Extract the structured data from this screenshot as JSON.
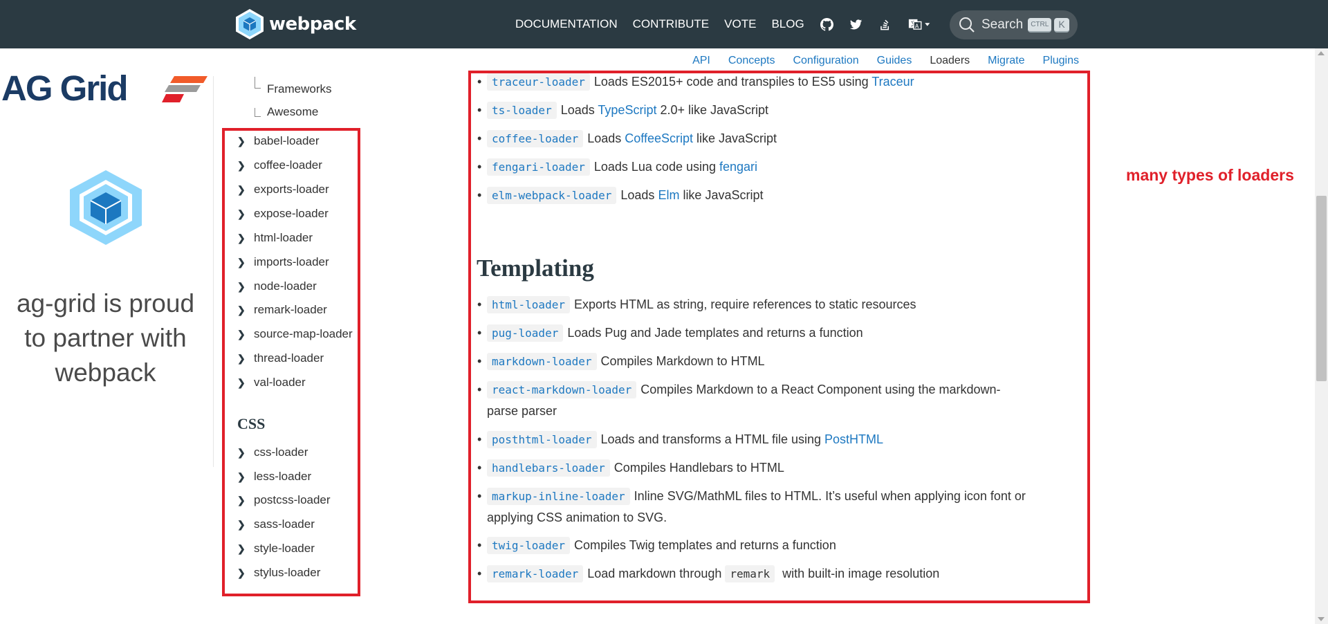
{
  "header": {
    "logo_text": "webpack",
    "nav": [
      "DOCUMENTATION",
      "CONTRIBUTE",
      "VOTE",
      "BLOG"
    ],
    "icons": [
      "github-icon",
      "twitter-icon",
      "stackoverflow-icon",
      "translate-icon",
      "theme-toggle-icon"
    ],
    "search_label": "Search",
    "kbd_ctrl": "CTRL",
    "kbd_k": "K"
  },
  "subnav": {
    "items": [
      "API",
      "Concepts",
      "Configuration",
      "Guides",
      "Loaders",
      "Migrate",
      "Plugins"
    ],
    "active": "Loaders"
  },
  "ad": {
    "logo_text": "AG Grid",
    "text": "ag-grid is proud to partner with webpack"
  },
  "sidebar": {
    "tree": [
      "Frameworks",
      "Awesome"
    ],
    "files_items": [
      "babel-loader",
      "coffee-loader",
      "exports-loader",
      "expose-loader",
      "html-loader",
      "imports-loader",
      "node-loader",
      "remark-loader",
      "source-map-loader",
      "thread-loader",
      "val-loader"
    ],
    "css_heading": "CSS",
    "css_items": [
      "css-loader",
      "less-loader",
      "postcss-loader",
      "sass-loader",
      "style-loader",
      "stylus-loader"
    ]
  },
  "main": {
    "transpiling": [
      {
        "code": "traceur-loader",
        "pre": "Loads ES2015+ code and transpiles to ES5 using ",
        "link": "Traceur",
        "post": ""
      },
      {
        "code": "ts-loader",
        "pre": "Loads ",
        "link": "TypeScript",
        "post": " 2.0+ like JavaScript"
      },
      {
        "code": "coffee-loader",
        "pre": "Loads ",
        "link": "CoffeeScript",
        "post": " like JavaScript"
      },
      {
        "code": "fengari-loader",
        "pre": "Loads Lua code using ",
        "link": "fengari",
        "post": ""
      },
      {
        "code": "elm-webpack-loader",
        "pre": "Loads ",
        "link": "Elm",
        "post": " like JavaScript"
      }
    ],
    "templating_heading": "Templating",
    "templating": [
      {
        "code": "html-loader",
        "text": "Exports HTML as string, require references to static resources"
      },
      {
        "code": "pug-loader",
        "text": "Loads Pug and Jade templates and returns a function"
      },
      {
        "code": "markdown-loader",
        "text": "Compiles Markdown to HTML"
      },
      {
        "code": "react-markdown-loader",
        "text": "Compiles Markdown to a React Component using the markdown-",
        "text2": "parse parser"
      },
      {
        "code": "posthtml-loader",
        "text": "Loads and transforms a HTML file using ",
        "link": "PostHTML"
      },
      {
        "code": "handlebars-loader",
        "text": "Compiles Handlebars to HTML"
      },
      {
        "code": "markup-inline-loader",
        "text": "Inline SVG/MathML files to HTML. It’s useful when applying icon font or",
        "text2": "applying CSS animation to SVG."
      },
      {
        "code": "twig-loader",
        "text": "Compiles Twig templates and returns a function"
      },
      {
        "code": "remark-loader",
        "text": "Load markdown through ",
        "code2": "remark",
        "text3": " with built-in image resolution"
      }
    ]
  },
  "annotation": "many types of loaders",
  "colors": {
    "header_bg": "#2b3a42",
    "link": "#1d78c1",
    "annotation_red": "#e0202a"
  }
}
